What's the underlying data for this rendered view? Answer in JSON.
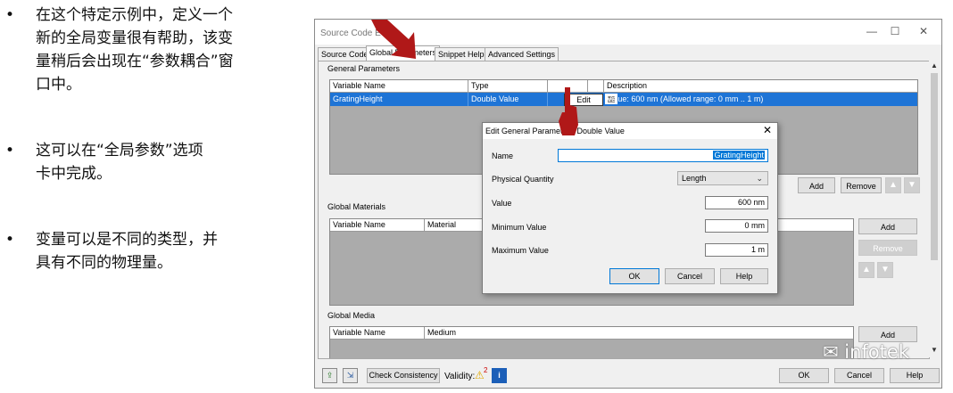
{
  "bullets": [
    {
      "lines": [
        "在这个特定示例中，定义一个",
        "新的全局变量很有帮助，该变",
        "量稍后会出现在“参数耦合”窗",
        "口中。"
      ]
    },
    {
      "lines": [
        "这可以在“全局参数”选项",
        "卡中完成。"
      ]
    },
    {
      "lines": [
        "变量可以是不同的类型，并",
        "具有不同的物理量。"
      ]
    }
  ],
  "bullet_symbol": "•",
  "window": {
    "title": "Source Code E",
    "tabs": [
      "Source Code",
      "Global Parameters",
      "Snippet Help",
      "Advanced Settings"
    ],
    "active_tab": "Global Parameters",
    "global_parameters": {
      "label": "General Parameters",
      "columns": [
        "Variable Name",
        "Type",
        "",
        "",
        "Description"
      ],
      "rows": [
        {
          "name": "GratingHeight",
          "type": "Double Value",
          "edit": "Edit",
          "description": "Value: 600 nm (Allowed range: 0 mm .. 1 m)"
        }
      ],
      "add": "Add",
      "remove": "Remove"
    },
    "global_materials": {
      "label": "Global Materials",
      "columns": [
        "Variable Name",
        "Material"
      ],
      "add": "Add",
      "remove": "Remove"
    },
    "global_media": {
      "label": "Global Media",
      "columns": [
        "Variable Name",
        "Medium"
      ],
      "add": "Add"
    },
    "bottom": {
      "check_consistency": "Check Consistency",
      "validity_label": "Validity:",
      "validity_count": "2",
      "ok": "OK",
      "cancel": "Cancel",
      "help": "Help"
    }
  },
  "dialog": {
    "title": "Edit General Parameter - Double Value",
    "fields": {
      "name_label": "Name",
      "name_value": "GratingHeight",
      "quantity_label": "Physical Quantity",
      "quantity_value": "Length",
      "value_label": "Value",
      "value_value": "600 nm",
      "min_label": "Minimum Value",
      "min_value": "0 mm",
      "max_label": "Maximum Value",
      "max_value": "1 m"
    },
    "ok": "OK",
    "cancel": "Cancel",
    "help": "Help"
  },
  "watermark": "infotek",
  "colors": {
    "selection": "#1e74d6",
    "arrow": "#b01818",
    "grid_bg": "#ababab"
  }
}
